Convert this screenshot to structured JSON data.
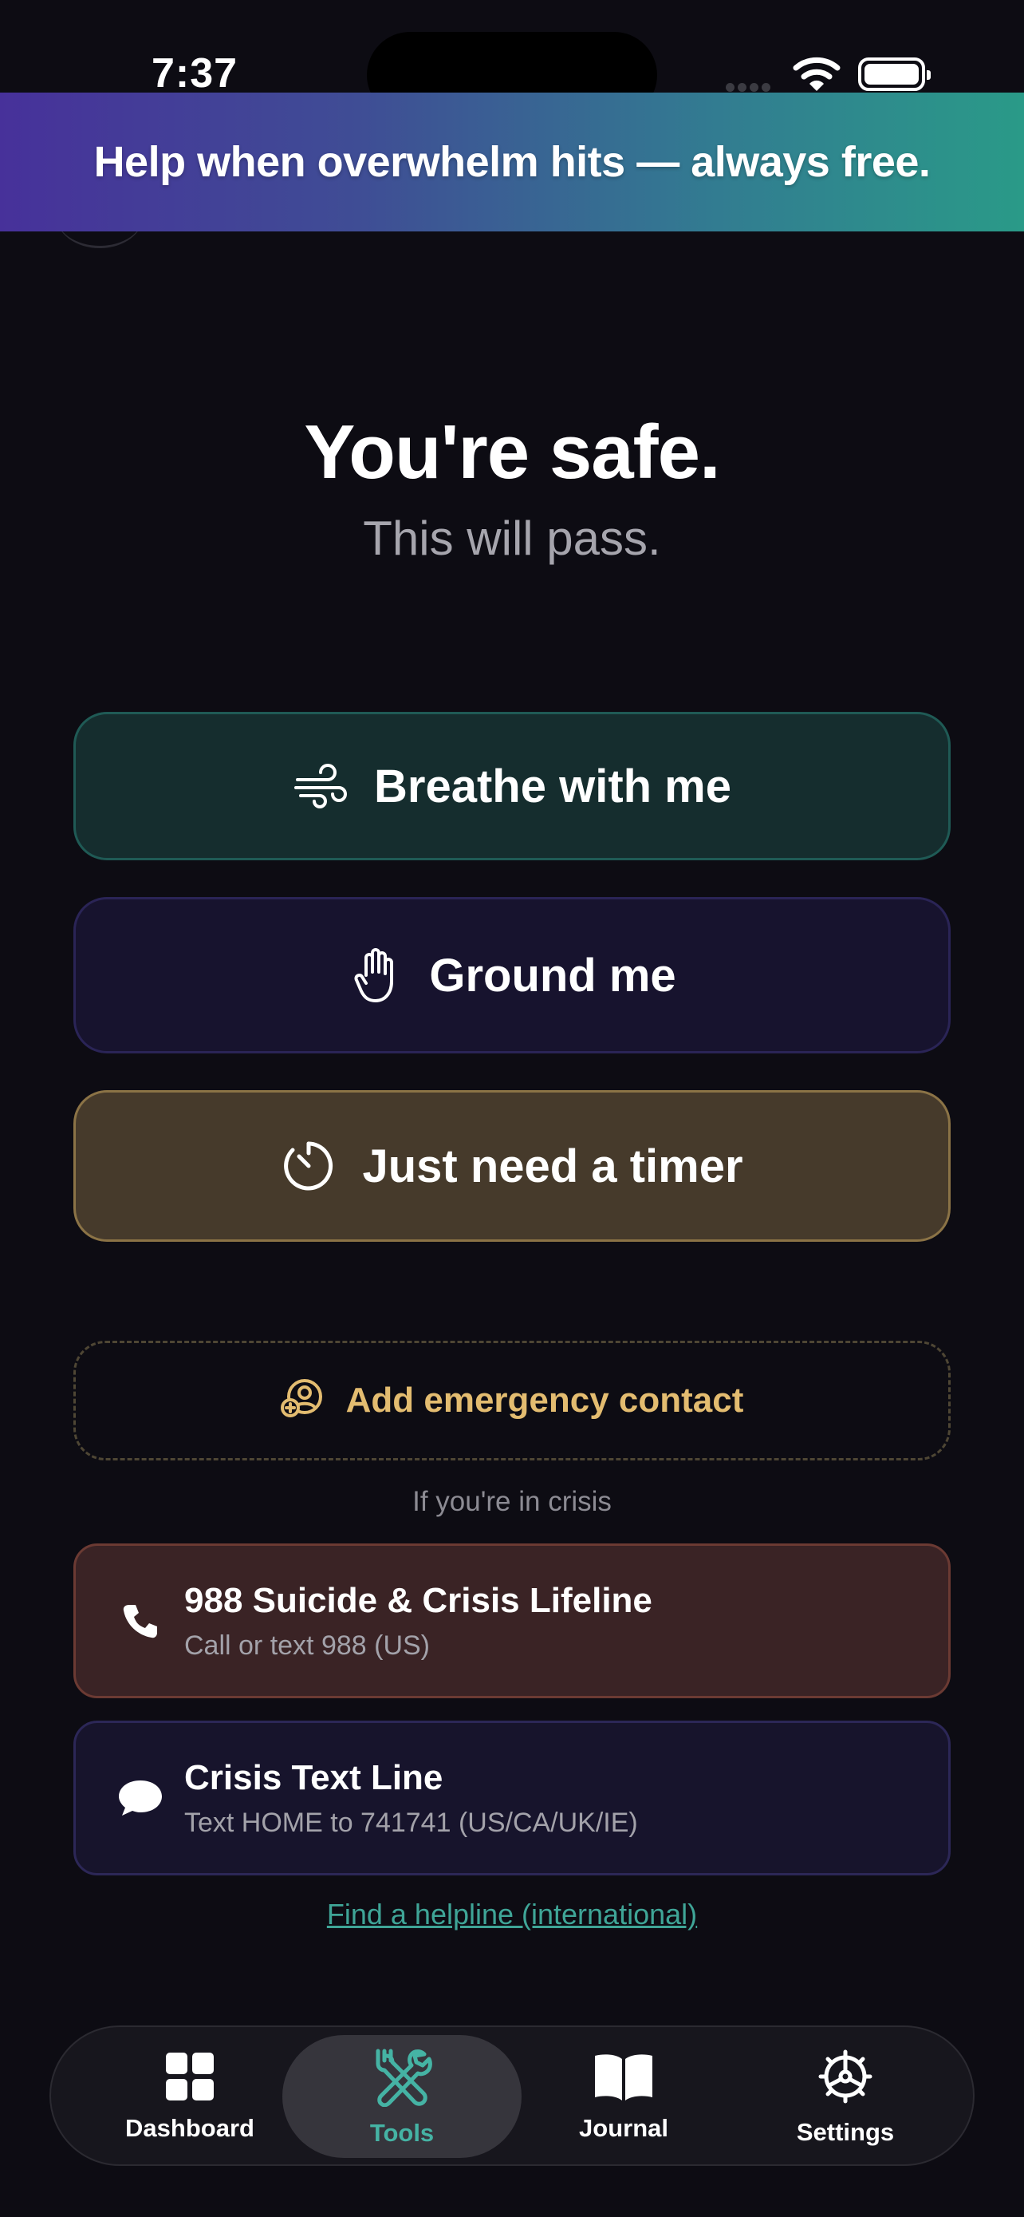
{
  "status_bar": {
    "time": "7:37"
  },
  "banner": {
    "text": "Help when overwhelm hits — always free."
  },
  "hero": {
    "title": "You're safe.",
    "subtitle": "This will pass."
  },
  "actions": {
    "breathe": {
      "label": "Breathe with me",
      "icon": "wind-icon",
      "accent": "#1f5a55"
    },
    "ground": {
      "label": "Ground me",
      "icon": "hand-icon",
      "accent": "#2a2456"
    },
    "timer": {
      "label": "Just need a timer",
      "icon": "timer-icon",
      "accent": "#8b7346"
    }
  },
  "emergency": {
    "label": "Add emergency contact",
    "icon": "add-contact-icon",
    "accent": "#e3bc70"
  },
  "crisis": {
    "heading": "If you're in crisis",
    "lifeline": {
      "title": "988 Suicide & Crisis Lifeline",
      "subtitle": "Call or text 988 (US)",
      "icon": "phone-icon"
    },
    "textline": {
      "title": "Crisis Text Line",
      "subtitle": "Text HOME to 741741 (US/CA/UK/IE)",
      "icon": "chat-bubble-icon"
    },
    "link": "Find a helpline (international)"
  },
  "tabbar": {
    "active": "Tools",
    "active_color": "#45b3a4",
    "items": [
      {
        "label": "Dashboard",
        "icon": "grid-icon"
      },
      {
        "label": "Tools",
        "icon": "tools-icon"
      },
      {
        "label": "Journal",
        "icon": "book-icon"
      },
      {
        "label": "Settings",
        "icon": "gear-icon"
      }
    ]
  }
}
